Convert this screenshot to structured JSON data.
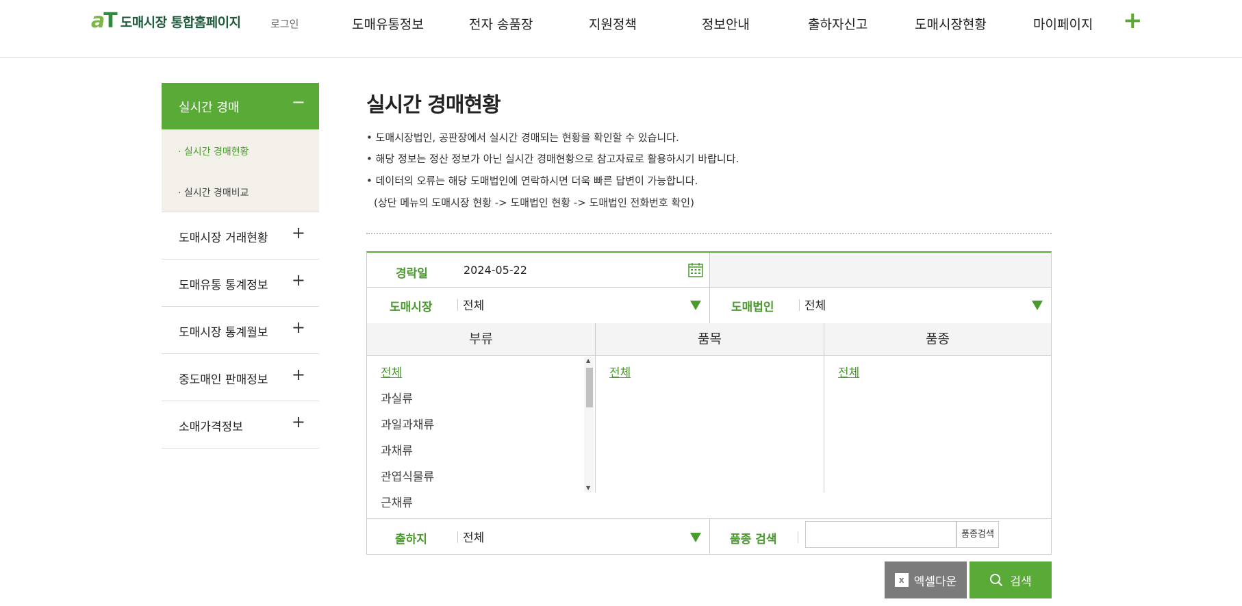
{
  "header": {
    "logo_mark": "aT",
    "logo_text": "도매시장 통합홈페이지",
    "login": "로그인",
    "nav": [
      "도매유통정보",
      "전자 송품장",
      "지원정책",
      "정보안내",
      "출하자신고",
      "도매시장현황",
      "마이페이지"
    ],
    "more_icon": "plus-icon"
  },
  "sidebar": {
    "active": {
      "label": "실시간 경매",
      "toggle": "−"
    },
    "sub_items": [
      "실시간 경매현황",
      "실시간 경매비교"
    ],
    "items": [
      {
        "label": "도매시장 거래현황",
        "toggle": "+"
      },
      {
        "label": "도매유통 통계정보",
        "toggle": "+"
      },
      {
        "label": "도매시장 통계월보",
        "toggle": "+"
      },
      {
        "label": "중도매인 판매정보",
        "toggle": "+"
      },
      {
        "label": "소매가격정보",
        "toggle": "+"
      }
    ]
  },
  "main": {
    "title": "실시간 경매현황",
    "descriptions": [
      "• 도매시장법인, 공판장에서 실시간 경매되는 현황을 확인할 수 있습니다.",
      "• 해당 정보는 정산 정보가 아닌 실시간 경매현황으로 참고자료로 활용하시기 바랍니다.",
      "• 데이터의 오류는 해당 도매법인에 연락하시면 더욱 빠른 답변이 가능합니다.",
      "(상단 메뉴의 도매시장 현황 -> 도매법인 현황 -> 도매법인 전화번호 확인)"
    ]
  },
  "form": {
    "date_label": "경락일",
    "date_value": "2024-05-22",
    "market_label": "도매시장",
    "market_value": "전체",
    "corp_label": "도매법인",
    "corp_value": "전체",
    "columns": [
      "부류",
      "품목",
      "품종"
    ],
    "category_list": [
      "전체",
      "과실류",
      "과일과채류",
      "과채류",
      "관엽식물류",
      "근채류"
    ],
    "item_list": [
      "전체"
    ],
    "variety_list": [
      "전체"
    ],
    "origin_label": "출하지",
    "origin_value": "전체",
    "variety_search_label": "품종 검색",
    "variety_search_value": "",
    "variety_search_button": "품종검색"
  },
  "actions": {
    "excel": "엑셀다운",
    "search": "검색"
  },
  "colors": {
    "accent": "#5aaa38",
    "label": "#4a9a2e",
    "excel_bg": "#7b7b7b"
  }
}
